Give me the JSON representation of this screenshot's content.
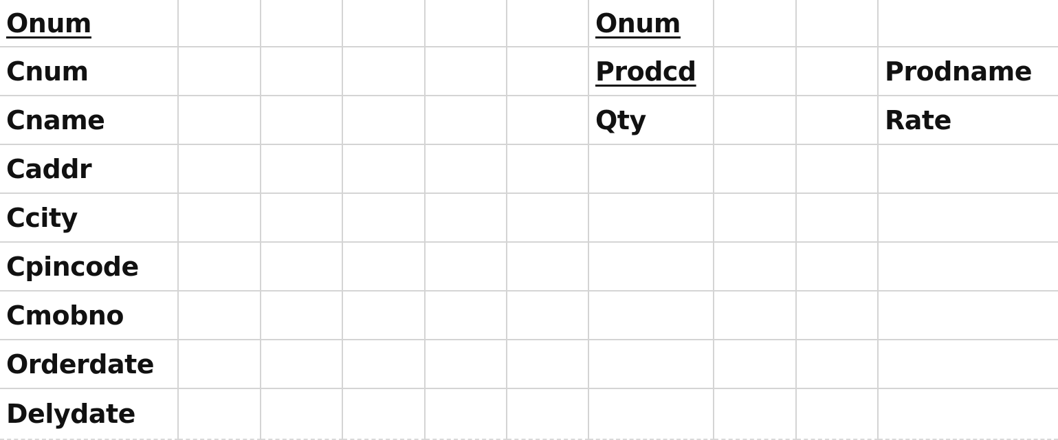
{
  "sheet": {
    "columns": 10,
    "cells": [
      [
        "Onum",
        "",
        "",
        "",
        "",
        "",
        "Onum",
        "",
        "",
        ""
      ],
      [
        "Cnum",
        "",
        "",
        "",
        "",
        "",
        "Prodcd",
        "",
        "",
        "Prodname"
      ],
      [
        "Cname",
        "",
        "",
        "",
        "",
        "",
        "Qty",
        "",
        "",
        "Rate"
      ],
      [
        "Caddr",
        "",
        "",
        "",
        "",
        "",
        "",
        "",
        "",
        ""
      ],
      [
        "Ccity",
        "",
        "",
        "",
        "",
        "",
        "",
        "",
        "",
        ""
      ],
      [
        "Cpincode",
        "",
        "",
        "",
        "",
        "",
        "",
        "",
        "",
        ""
      ],
      [
        "Cmobno",
        "",
        "",
        "",
        "",
        "",
        "",
        "",
        "",
        ""
      ],
      [
        "Orderdate",
        "",
        "",
        "",
        "",
        "",
        "",
        "",
        "",
        ""
      ],
      [
        "Delydate",
        "",
        "",
        "",
        "",
        "",
        "",
        "",
        "",
        ""
      ]
    ],
    "underlined": [
      [
        0,
        0
      ],
      [
        0,
        6
      ],
      [
        1,
        6
      ]
    ]
  }
}
